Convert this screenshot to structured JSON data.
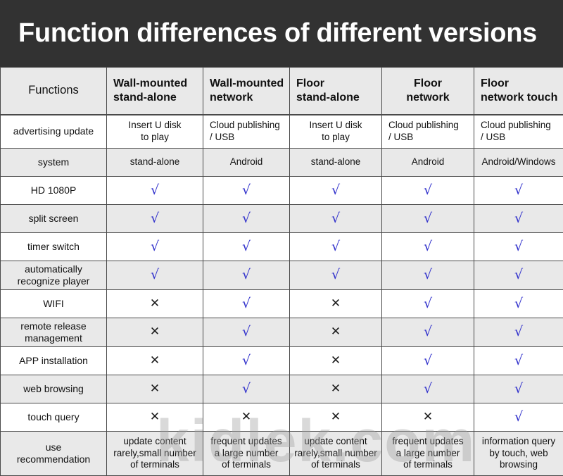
{
  "title": "Function differences of different versions",
  "watermark": "kidlek.com",
  "colors": {
    "banner_bg": "#323232",
    "header_bg": "#e9e9e9",
    "row_alt_bg": "#e9e9e9",
    "row_bg": "#ffffff",
    "check_color": "#3333cc",
    "cross_color": "#1a1a1a",
    "border": "#4a4a4a"
  },
  "marks": {
    "yes": "√",
    "no": "✕"
  },
  "table": {
    "columns": [
      "Functions",
      "Wall-mounted\nstand-alone",
      "Wall-mounted\nnetwork",
      "Floor\nstand-alone",
      "Floor\nnetwork",
      "Floor\nnetwork touch"
    ],
    "rows": [
      {
        "label": "advertising update",
        "type": "text",
        "cells": [
          "Insert U disk\nto play",
          "Cloud publishing\n/ USB",
          "Insert U disk\nto play",
          "Cloud publishing\n/ USB",
          "Cloud publishing\n/ USB"
        ]
      },
      {
        "label": "system",
        "type": "text",
        "cells": [
          "stand-alone",
          "Android",
          "stand-alone",
          "Android",
          "Android/Windows"
        ]
      },
      {
        "label": "HD 1080P",
        "type": "mark",
        "cells": [
          "yes",
          "yes",
          "yes",
          "yes",
          "yes"
        ]
      },
      {
        "label": "split screen",
        "type": "mark",
        "cells": [
          "yes",
          "yes",
          "yes",
          "yes",
          "yes"
        ]
      },
      {
        "label": "timer switch",
        "type": "mark",
        "cells": [
          "yes",
          "yes",
          "yes",
          "yes",
          "yes"
        ]
      },
      {
        "label": "automatically\nrecognize player",
        "type": "mark",
        "cells": [
          "yes",
          "yes",
          "yes",
          "yes",
          "yes"
        ]
      },
      {
        "label": "WIFI",
        "type": "mark",
        "cells": [
          "no",
          "yes",
          "no",
          "yes",
          "yes"
        ]
      },
      {
        "label": "remote release\nmanagement",
        "type": "mark",
        "cells": [
          "no",
          "yes",
          "no",
          "yes",
          "yes"
        ]
      },
      {
        "label": "APP installation",
        "type": "mark",
        "cells": [
          "no",
          "yes",
          "no",
          "yes",
          "yes"
        ]
      },
      {
        "label": "web browsing",
        "type": "mark",
        "cells": [
          "no",
          "yes",
          "no",
          "yes",
          "yes"
        ]
      },
      {
        "label": "touch query",
        "type": "mark",
        "cells": [
          "no",
          "no",
          "no",
          "no",
          "yes"
        ]
      },
      {
        "label": "use\nrecommendation",
        "type": "text",
        "cells": [
          "update content\nrarely,small number\nof terminals",
          "frequent updates\na large number\nof terminals",
          "update content\nrarely,small number\nof terminals",
          "frequent updates\na large number\nof terminals",
          "information query\nby touch, web\nbrowsing"
        ]
      }
    ]
  }
}
